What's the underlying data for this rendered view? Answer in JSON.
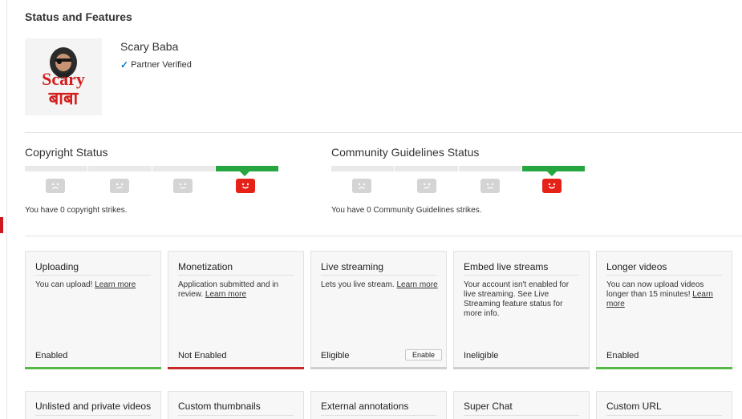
{
  "page": {
    "title": "Status and Features"
  },
  "channel": {
    "name": "Scary Baba",
    "verified_label": "Partner Verified",
    "logo_text_top": "Scary",
    "logo_text_bottom": "बाबा"
  },
  "copyright": {
    "title": "Copyright Status",
    "strikes": 0,
    "message": "You have 0 copyright strikes."
  },
  "community": {
    "title": "Community Guidelines Status",
    "strikes": 0,
    "message": "You have 0 Community Guidelines strikes."
  },
  "features": [
    {
      "title": "Uploading",
      "desc": "You can upload!",
      "link": "Learn more",
      "status": "Enabled",
      "state": "green"
    },
    {
      "title": "Monetization",
      "desc": "Application submitted and in review.",
      "link": "Learn more",
      "status": "Not Enabled",
      "state": "red"
    },
    {
      "title": "Live streaming",
      "desc": "Lets you live stream.",
      "link": "Learn more",
      "status": "Eligible",
      "state": "grey",
      "button": "Enable"
    },
    {
      "title": "Embed live streams",
      "desc": "Your account isn't enabled for live streaming. See Live Streaming feature status for more info.",
      "link": "",
      "status": "Ineligible",
      "state": "grey"
    },
    {
      "title": "Longer videos",
      "desc": "You can now upload videos longer than 15 minutes!",
      "link": "Learn more",
      "status": "Enabled",
      "state": "green"
    }
  ],
  "features_row2": [
    {
      "title": "Unlisted and private videos"
    },
    {
      "title": "Custom thumbnails"
    },
    {
      "title": "External annotations"
    },
    {
      "title": "Super Chat"
    },
    {
      "title": "Custom URL"
    }
  ],
  "colors": {
    "accent_green": "#26a641",
    "strike_red": "#e62117",
    "not_enabled_red": "#c62828",
    "link_blue": "#167ac6"
  }
}
